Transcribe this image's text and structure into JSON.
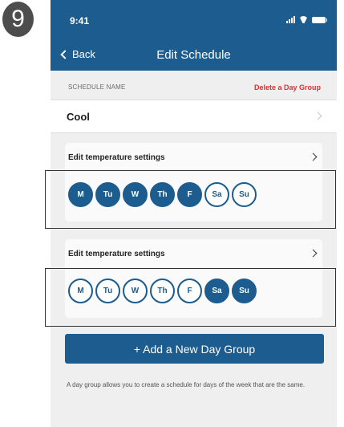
{
  "step_badge": "9",
  "status_bar": {
    "time": "9:41",
    "icons": [
      "signal-icon",
      "wifi-icon",
      "battery-icon"
    ]
  },
  "header": {
    "back_label": "Back",
    "title": "Edit Schedule",
    "color": "#1c5c8e"
  },
  "schedule_name_section": {
    "label": "SCHEDULE NAME",
    "delete_label": "Delete a Day Group",
    "delete_color": "#e0302f"
  },
  "schedule_name": {
    "value": "Cool"
  },
  "day_groups": [
    {
      "title": "Edit temperature settings",
      "days": [
        {
          "label": "M",
          "selected": true
        },
        {
          "label": "Tu",
          "selected": true
        },
        {
          "label": "W",
          "selected": true
        },
        {
          "label": "Th",
          "selected": true
        },
        {
          "label": "F",
          "selected": true
        },
        {
          "label": "Sa",
          "selected": false
        },
        {
          "label": "Su",
          "selected": false
        }
      ]
    },
    {
      "title": "Edit temperature settings",
      "days": [
        {
          "label": "M",
          "selected": false
        },
        {
          "label": "Tu",
          "selected": false
        },
        {
          "label": "W",
          "selected": false
        },
        {
          "label": "Th",
          "selected": false
        },
        {
          "label": "F",
          "selected": false
        },
        {
          "label": "Sa",
          "selected": true
        },
        {
          "label": "Su",
          "selected": true
        }
      ]
    }
  ],
  "add_button_label": "+ Add a New Day Group",
  "help_text": "A day group allows you to create a schedule for days of the week that are the same."
}
